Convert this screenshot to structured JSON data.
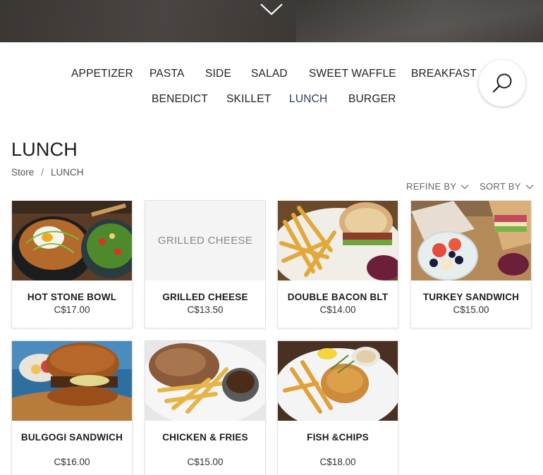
{
  "nav": {
    "items": [
      "APPETIZER",
      "PASTA",
      "SIDE",
      "SALAD",
      "SWEET WAFFLE",
      "BREAKFAST",
      "BENEDICT",
      "SKILLET",
      "LUNCH",
      "BURGER"
    ],
    "active": "LUNCH"
  },
  "page": {
    "title": "LUNCH",
    "breadcrumb": [
      "Store",
      "LUNCH"
    ],
    "breadcrumb_separator": "/"
  },
  "toolbar": {
    "refine_label": "REFINE BY",
    "sort_label": "SORT BY"
  },
  "products": [
    {
      "name": "HOT STONE BOWL",
      "price": "C$17.00",
      "image": "hot-stone-bowl-photo"
    },
    {
      "name": "GRILLED CHEESE",
      "price": "C$13.50",
      "image_placeholder": "GRILLED CHEESE"
    },
    {
      "name": "DOUBLE BACON BLT",
      "price": "C$14.00",
      "image": "blt-sandwich-fries-photo"
    },
    {
      "name": "TURKEY SANDWICH",
      "price": "C$15.00",
      "image": "turkey-sandwich-fruit-photo"
    },
    {
      "name": "BULGOGI SANDWICH",
      "price": "C$16.00",
      "image": "bulgogi-burger-photo"
    },
    {
      "name": "CHICKEN & FRIES",
      "price": "C$15.00",
      "image": "chicken-fries-photo"
    },
    {
      "name": "FISH &CHIPS",
      "price": "C$18.00",
      "image": "fish-chips-photo"
    }
  ],
  "colors": {
    "active_nav": "#2c3b5a",
    "card_border": "#e2e2e2",
    "placeholder_bg": "#f4f4f4"
  },
  "icons": [
    "chevron-down-icon",
    "search-icon",
    "refine-chevron-icon",
    "sort-chevron-icon"
  ]
}
